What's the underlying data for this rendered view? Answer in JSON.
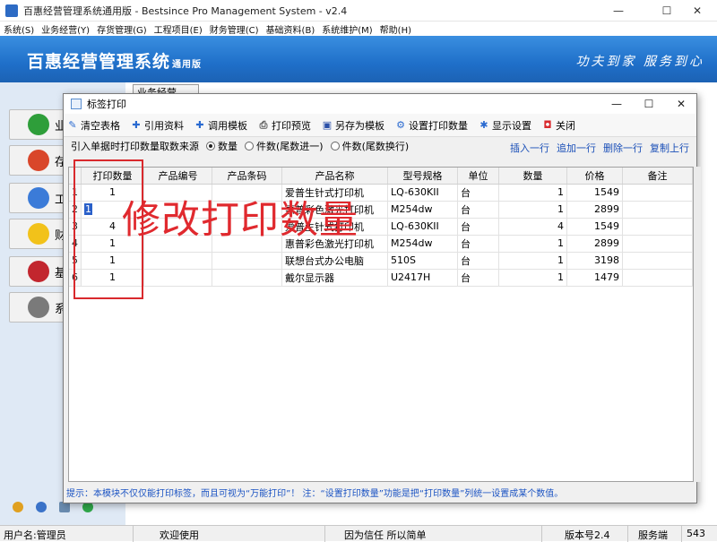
{
  "app": {
    "title": "百惠经营管理系统通用版 - Bestsince Pro Management System - v2.4",
    "menu": [
      "系统(S)",
      "业务经营(Y)",
      "存货管理(G)",
      "工程项目(E)",
      "财务管理(C)",
      "基础资料(B)",
      "系统维护(M)",
      "帮助(H)"
    ],
    "banner_title": "百惠经营管理系统",
    "banner_sub": "通用版",
    "banner_slogan": "功夫到家 服务到心",
    "bg_tab": "业务经营",
    "left_nav": [
      {
        "label": "业",
        "icon": "check-icon",
        "color": "#2e9e3a"
      },
      {
        "label": "存",
        "icon": "house-icon",
        "color": "#d9462a"
      },
      {
        "label": "工",
        "icon": "cycle-icon",
        "color": "#3b7bd8"
      },
      {
        "label": "财",
        "icon": "star-icon",
        "color": "#f2c21a"
      },
      {
        "label": "基",
        "icon": "book-icon",
        "color": "#c2262e"
      },
      {
        "label": "系",
        "icon": "gear-icon",
        "color": "#7a7a7a"
      }
    ]
  },
  "statusbar": {
    "user": "用户名:管理员",
    "welcome": "欢迎使用",
    "motto": "因为信任 所以简单",
    "version": "版本号2.4",
    "server": "服务端",
    "port": "543"
  },
  "dialog": {
    "title": "标签打印",
    "toolbar": [
      {
        "label": "清空表格",
        "icon": "broom-icon",
        "glyph": "✎",
        "color": "#2a6ad0"
      },
      {
        "label": "引用资料",
        "icon": "plus-icon",
        "glyph": "✚",
        "color": "#2a6ad0"
      },
      {
        "label": "调用模板",
        "icon": "plus-icon",
        "glyph": "✚",
        "color": "#2a6ad0"
      },
      {
        "label": "打印预览",
        "icon": "printer-icon",
        "glyph": "⎙",
        "color": "#555555"
      },
      {
        "label": "另存为模板",
        "icon": "save-icon",
        "glyph": "▣",
        "color": "#2a4fa8"
      },
      {
        "label": "设置打印数量",
        "icon": "settings-icon",
        "glyph": "⚙",
        "color": "#2a6ad0"
      },
      {
        "label": "显示设置",
        "icon": "display-icon",
        "glyph": "✱",
        "color": "#2a6ad0"
      },
      {
        "label": "关闭",
        "icon": "close-icon",
        "glyph": "◘",
        "color": "#d9292d"
      }
    ],
    "source_label": "引入单据时打印数量取数来源",
    "radios": [
      {
        "label": "数量",
        "checked": true
      },
      {
        "label": "件数(尾数进一)",
        "checked": false
      },
      {
        "label": "件数(尾数换行)",
        "checked": false
      }
    ],
    "row_actions": [
      "插入一行",
      "追加一行",
      "删除一行",
      "复制上行"
    ],
    "columns": [
      "",
      "打印数量",
      "产品编号",
      "产品条码",
      "产品名称",
      "型号规格",
      "单位",
      "数量",
      "价格",
      "备注"
    ],
    "rows": [
      {
        "no": "1",
        "print_qty": "1",
        "code": "",
        "barcode": "",
        "name": "爱普生针式打印机",
        "model": "LQ-630KII",
        "unit": "台",
        "qty": "1",
        "price": "1549",
        "note": ""
      },
      {
        "no": "2",
        "print_qty": "1",
        "code": "",
        "barcode": "",
        "name": "惠普彩色激光打印机",
        "model": "M254dw",
        "unit": "台",
        "qty": "1",
        "price": "2899",
        "note": ""
      },
      {
        "no": "3",
        "print_qty": "4",
        "code": "",
        "barcode": "",
        "name": "爱普生针式打印机",
        "model": "LQ-630KII",
        "unit": "台",
        "qty": "4",
        "price": "1549",
        "note": ""
      },
      {
        "no": "4",
        "print_qty": "1",
        "code": "",
        "barcode": "",
        "name": "惠普彩色激光打印机",
        "model": "M254dw",
        "unit": "台",
        "qty": "1",
        "price": "2899",
        "note": ""
      },
      {
        "no": "5",
        "print_qty": "1",
        "code": "",
        "barcode": "",
        "name": "联想台式办公电脑",
        "model": "510S",
        "unit": "台",
        "qty": "1",
        "price": "3198",
        "note": ""
      },
      {
        "no": "6",
        "print_qty": "1",
        "code": "",
        "barcode": "",
        "name": "戴尔显示器",
        "model": "U2417H",
        "unit": "台",
        "qty": "1",
        "price": "1479",
        "note": ""
      }
    ],
    "hint": "提示：本模块不仅仅能打印标签，而且可视为“万能打印”！ 注：“设置打印数量”功能是把“打印数量”列统一设置成某个数值。"
  },
  "annotation": {
    "text": "修改打印数量"
  }
}
